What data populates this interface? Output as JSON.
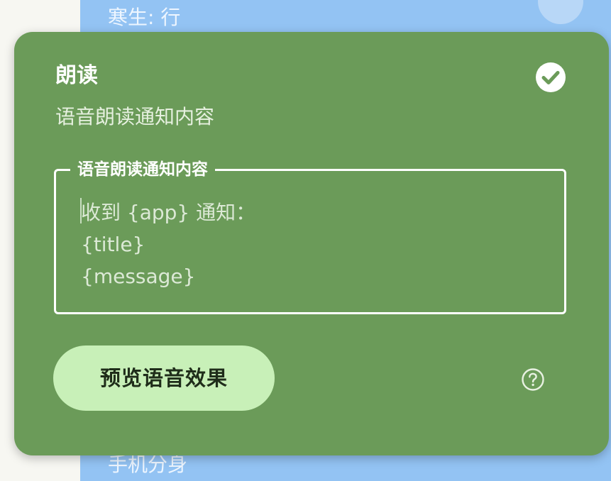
{
  "background": {
    "top_partial_text": "寒生: 行",
    "bottom_partial_text": "手机分身"
  },
  "card": {
    "title": "朗读",
    "subtitle": "语音朗读通知内容",
    "enabled_icon": "check-circle-icon",
    "field": {
      "label": "语音朗读通知内容",
      "value": "收到 {app} 通知：\n{title}\n{message}"
    },
    "preview_button_label": "预览语音效果",
    "help_icon": "question-circle-icon"
  },
  "colors": {
    "card_background": "#6b9b59",
    "button_background": "#c8f0b8",
    "background_strip": "#93c3f3"
  }
}
